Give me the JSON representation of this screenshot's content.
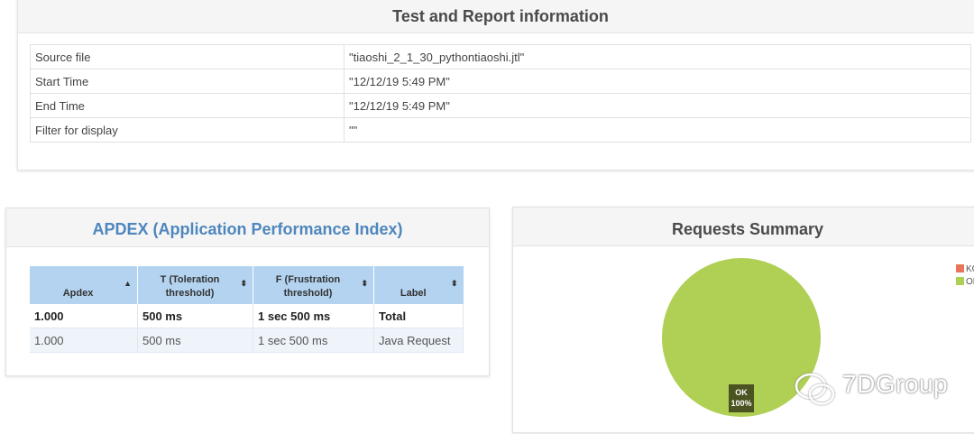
{
  "report_info": {
    "title": "Test and Report information",
    "rows": [
      {
        "key": "Source file",
        "value": "\"tiaoshi_2_1_30_pythontiaoshi.jtl\""
      },
      {
        "key": "Start Time",
        "value": "\"12/12/19 5:49 PM\""
      },
      {
        "key": "End Time",
        "value": "\"12/12/19 5:49 PM\""
      },
      {
        "key": "Filter for display",
        "value": "\"\""
      }
    ]
  },
  "apdex": {
    "title": "APDEX (Application Performance Index)",
    "columns": [
      "Apdex",
      "T (Toleration threshold)",
      "F (Frustration threshold)",
      "Label"
    ],
    "rows": [
      [
        "1.000",
        "500 ms",
        "1 sec 500 ms",
        "Total"
      ],
      [
        "1.000",
        "500 ms",
        "1 sec 500 ms",
        "Java Request"
      ]
    ],
    "header_color": "#b3d3f0",
    "title_color": "#4e86bd"
  },
  "requests_summary": {
    "title": "Requests Summary",
    "legend": [
      {
        "label": "KO",
        "color": "#e8745b"
      },
      {
        "label": "OK",
        "color": "#b0cf55"
      }
    ],
    "pie_label": "OK",
    "pie_percent": "100%",
    "chart_data": {
      "type": "pie",
      "categories": [
        "KO",
        "OK"
      ],
      "values": [
        0,
        100
      ]
    }
  },
  "watermark": "7DGroup"
}
